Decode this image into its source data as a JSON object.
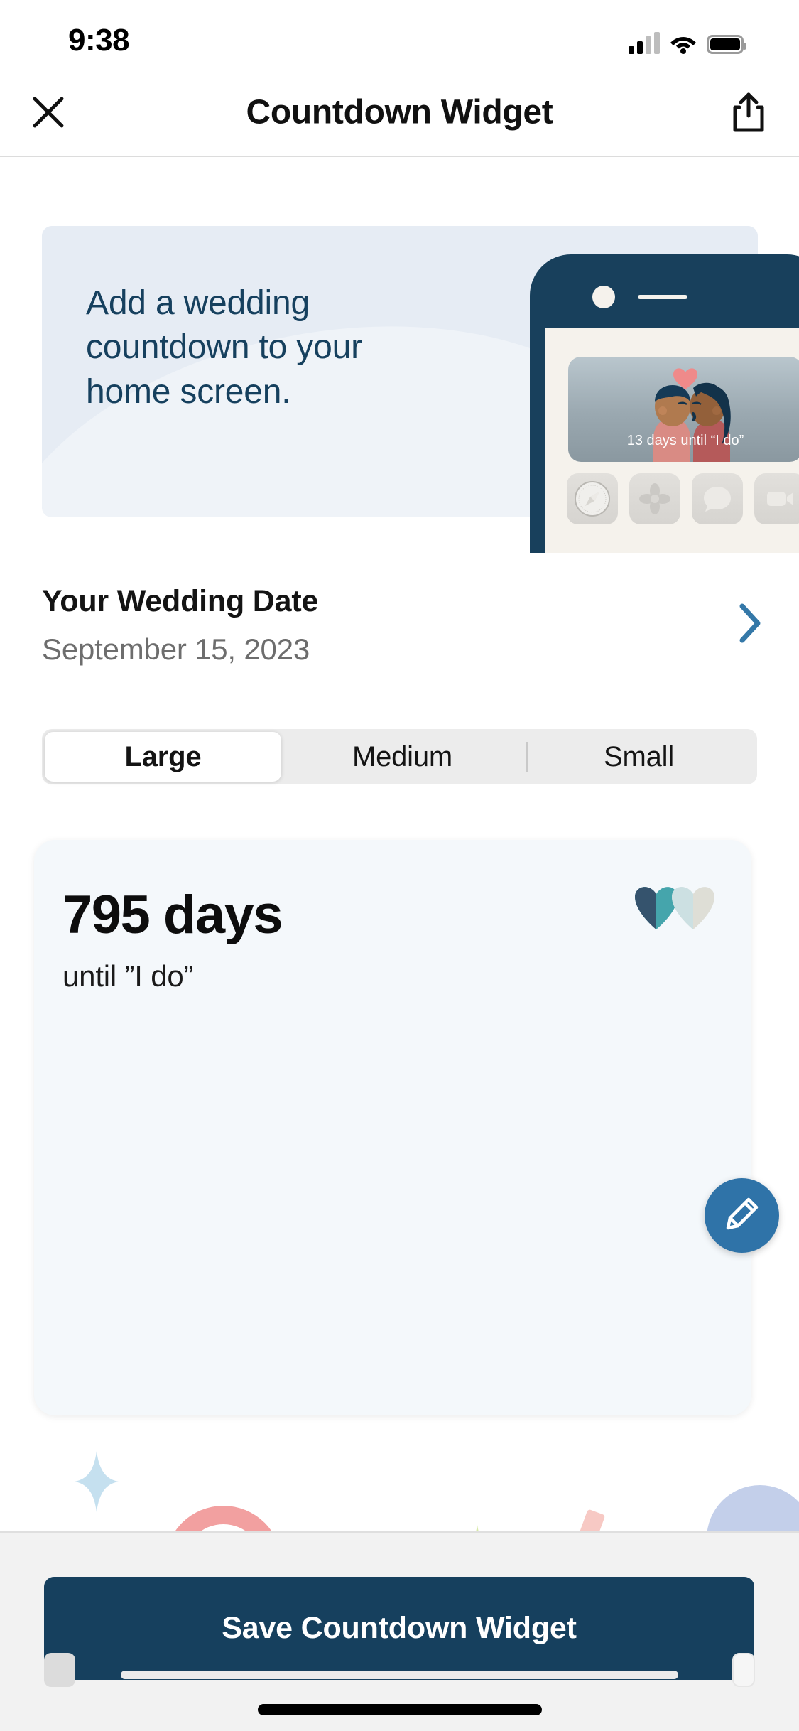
{
  "status_bar": {
    "time": "9:38",
    "cellular_icon": "cellular-signal-icon",
    "wifi_icon": "wifi-icon",
    "battery_icon": "battery-full-icon"
  },
  "nav_bar": {
    "close_icon": "close-icon",
    "title": "Countdown Widget",
    "share_icon": "share-icon"
  },
  "banner": {
    "headline": "Add a wedding countdown to your home screen.",
    "phone_mockup": {
      "widget_caption": "13 days until “I do”",
      "widget_art": "couple-kissing-illustration",
      "heart_icon": "heart-icon",
      "dock_apps": [
        "safari-icon",
        "photos-icon",
        "messages-icon",
        "facetime-icon"
      ]
    }
  },
  "wedding_date_row": {
    "title": "Your Wedding Date",
    "value": "September 15, 2023",
    "chevron_icon": "chevron-right-icon",
    "chevron_color": "#3478a8"
  },
  "size_selector": {
    "options": [
      "Large",
      "Medium",
      "Small"
    ],
    "selected": "Large"
  },
  "widget_preview": {
    "days": "795 days",
    "subtitle": "until ”I do”",
    "logo_icon": "double-heart-logo-icon",
    "decorations": [
      "sparkle-blue",
      "sparkle-green",
      "arch-pink",
      "sliver-pink",
      "blob-blue"
    ]
  },
  "edit_fab": {
    "icon": "pencil-icon",
    "color": "#2f73a8"
  },
  "bottom_bar": {
    "save_label": "Save Countdown Widget",
    "save_color": "#16405e",
    "home_indicator": "home-indicator"
  },
  "colors": {
    "brand_navy": "#16405e",
    "accent_blue": "#3478a8",
    "banner_bg": "#e6ecf4",
    "preview_bg": "#f4f8fb"
  }
}
